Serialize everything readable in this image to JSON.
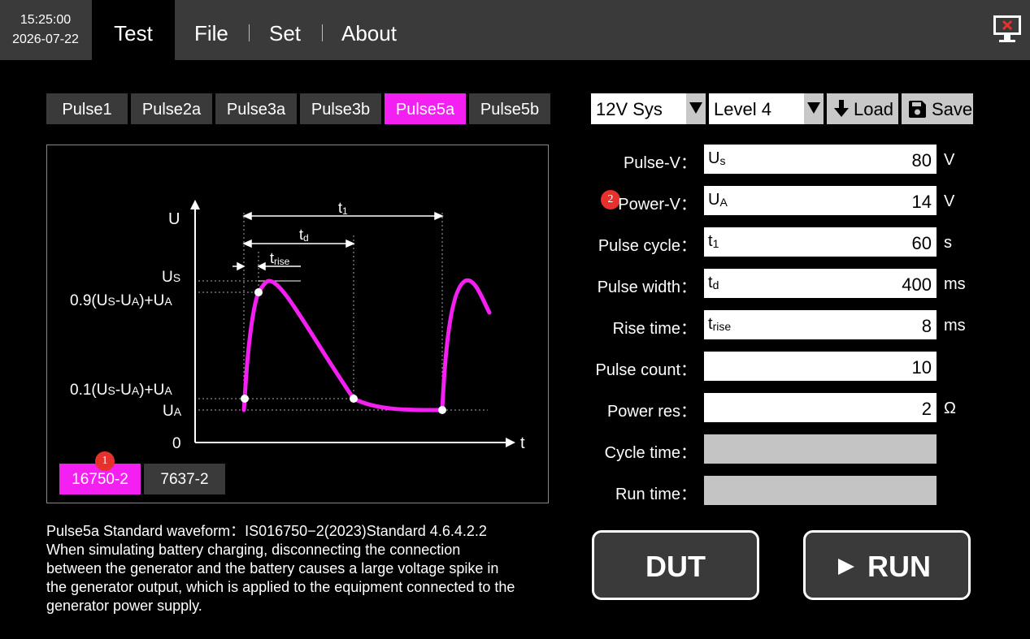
{
  "clock": {
    "time": "15:25:00",
    "date": "2026-07-22"
  },
  "menu": {
    "test": "Test",
    "file": "File",
    "set": "Set",
    "about": "About"
  },
  "pulse_tabs": [
    "Pulse1",
    "Pulse2a",
    "Pulse3a",
    "Pulse3b",
    "Pulse5a",
    "Pulse5b"
  ],
  "active_pulse_tab": "Pulse5a",
  "waveform": {
    "axis_u": "U",
    "axis_t": "t",
    "t1": "t",
    "t1_sub": "1",
    "td": "t",
    "td_sub": "d",
    "trise": "t",
    "trise_sub": "rise",
    "us": "U",
    "us_sub": "S",
    "l09a": "0.9(U",
    "l09b": "S",
    "l09c": "-U",
    "l09d": "A",
    "l09e": ")+U",
    "l09f": "A",
    "l01a": "0.1(U",
    "l01b": "S",
    "l01c": "-U",
    "l01d": "A",
    "l01e": ")+U",
    "l01f": "A",
    "ua": "U",
    "ua_sub": "A",
    "zero": "0"
  },
  "standards": [
    "16750-2",
    "7637-2"
  ],
  "badges": {
    "one": "1",
    "two": "2"
  },
  "description": {
    "line1": "Pulse5a Standard waveform：IS016750−2(2023)Standard 4.6.4.2.2",
    "line2": "When simulating battery charging, disconnecting the connection",
    "line3": "between the generator and the battery causes a large voltage spike in",
    "line4": "the generator output, which is applied to the equipment connected to the",
    "line5": "generator power supply."
  },
  "controls": {
    "system": "12V Sys",
    "level": "Level 4",
    "load": "Load",
    "save": "Save"
  },
  "params": {
    "pulse_v": {
      "label": "Pulse-V：",
      "sym": "U",
      "sub": "s",
      "value": "80",
      "unit": "V"
    },
    "power_v": {
      "label": "Power-V：",
      "sym": "U",
      "sub": "A",
      "value": "14",
      "unit": "V"
    },
    "pulse_cycle": {
      "label": "Pulse cycle：",
      "sym": "t",
      "sub": "1",
      "value": "60",
      "unit": "s"
    },
    "pulse_width": {
      "label": "Pulse width：",
      "sym": "t",
      "sub": "d",
      "value": "400",
      "unit": "ms"
    },
    "rise_time": {
      "label": "Rise time：",
      "sym": "t",
      "sub": "rise",
      "value": "8",
      "unit": "ms"
    },
    "pulse_count": {
      "label": "Pulse count：",
      "value": "10"
    },
    "power_res": {
      "label": "Power res：",
      "value": "2",
      "unit": "Ω"
    },
    "cycle_time": {
      "label": "Cycle time：",
      "value": ""
    },
    "run_time": {
      "label": "Run time：",
      "value": ""
    }
  },
  "buttons": {
    "dut": "DUT",
    "run": "RUN"
  },
  "colors": {
    "accent": "#f41ff1",
    "badge": "#e8302c",
    "panel": "#3a3a3a"
  }
}
